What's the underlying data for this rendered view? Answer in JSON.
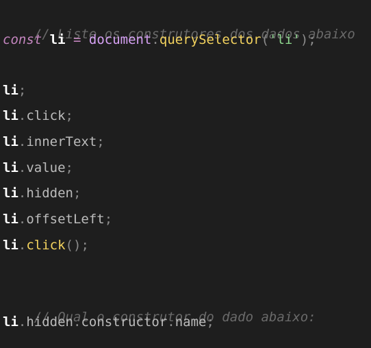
{
  "editor": {
    "lines": [
      {
        "comment": "// Liste os construtores dos dados abaixo"
      },
      {
        "keyword": "const",
        "var": "li",
        "op": "=",
        "obj": "document",
        "dot": ".",
        "method": "querySelector",
        "open": "(",
        "string": "'li'",
        "close": ")",
        "semi": ";"
      },
      {
        "var": "li",
        "semi": ";"
      },
      {
        "var": "li",
        "dot": ".",
        "prop": "click",
        "semi": ";"
      },
      {
        "var": "li",
        "dot": ".",
        "prop": "innerText",
        "semi": ";"
      },
      {
        "var": "li",
        "dot": ".",
        "prop": "value",
        "semi": ";"
      },
      {
        "var": "li",
        "dot": ".",
        "prop": "hidden",
        "semi": ";"
      },
      {
        "var": "li",
        "dot": ".",
        "prop": "offsetLeft",
        "semi": ";"
      },
      {
        "var": "li",
        "dot": ".",
        "method": "click",
        "parens": "()",
        "semi": ";"
      },
      {
        "comment": "// Qual o construtor do dado abaixo:"
      },
      {
        "var": "li",
        "dot": ".",
        "prop1": "hidden",
        "dot2": ".",
        "prop2": "constructor",
        "dot3": ".",
        "prop3": "name",
        "semi": ";"
      }
    ]
  },
  "colors": {
    "background": "#1e1e1e",
    "comment": "#6a6a6a",
    "keyword": "#c586c0",
    "variable": "#ffffff",
    "object": "#d7a2f5",
    "function": "#f4d35e",
    "string": "#8fd98f",
    "property": "#bcbcbc",
    "punctuation": "#8c8c8c"
  }
}
